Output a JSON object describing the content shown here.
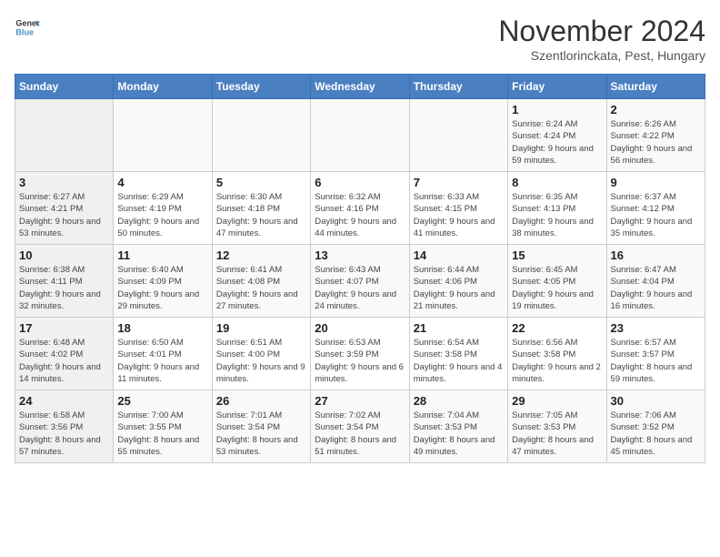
{
  "header": {
    "logo_general": "General",
    "logo_blue": "Blue",
    "title": "November 2024",
    "location": "Szentlorinckata, Pest, Hungary"
  },
  "days_of_week": [
    "Sunday",
    "Monday",
    "Tuesday",
    "Wednesday",
    "Thursday",
    "Friday",
    "Saturday"
  ],
  "weeks": [
    [
      {
        "day": "",
        "info": ""
      },
      {
        "day": "",
        "info": ""
      },
      {
        "day": "",
        "info": ""
      },
      {
        "day": "",
        "info": ""
      },
      {
        "day": "",
        "info": ""
      },
      {
        "day": "1",
        "info": "Sunrise: 6:24 AM\nSunset: 4:24 PM\nDaylight: 9 hours and 59 minutes."
      },
      {
        "day": "2",
        "info": "Sunrise: 6:26 AM\nSunset: 4:22 PM\nDaylight: 9 hours and 56 minutes."
      }
    ],
    [
      {
        "day": "3",
        "info": "Sunrise: 6:27 AM\nSunset: 4:21 PM\nDaylight: 9 hours and 53 minutes."
      },
      {
        "day": "4",
        "info": "Sunrise: 6:29 AM\nSunset: 4:19 PM\nDaylight: 9 hours and 50 minutes."
      },
      {
        "day": "5",
        "info": "Sunrise: 6:30 AM\nSunset: 4:18 PM\nDaylight: 9 hours and 47 minutes."
      },
      {
        "day": "6",
        "info": "Sunrise: 6:32 AM\nSunset: 4:16 PM\nDaylight: 9 hours and 44 minutes."
      },
      {
        "day": "7",
        "info": "Sunrise: 6:33 AM\nSunset: 4:15 PM\nDaylight: 9 hours and 41 minutes."
      },
      {
        "day": "8",
        "info": "Sunrise: 6:35 AM\nSunset: 4:13 PM\nDaylight: 9 hours and 38 minutes."
      },
      {
        "day": "9",
        "info": "Sunrise: 6:37 AM\nSunset: 4:12 PM\nDaylight: 9 hours and 35 minutes."
      }
    ],
    [
      {
        "day": "10",
        "info": "Sunrise: 6:38 AM\nSunset: 4:11 PM\nDaylight: 9 hours and 32 minutes."
      },
      {
        "day": "11",
        "info": "Sunrise: 6:40 AM\nSunset: 4:09 PM\nDaylight: 9 hours and 29 minutes."
      },
      {
        "day": "12",
        "info": "Sunrise: 6:41 AM\nSunset: 4:08 PM\nDaylight: 9 hours and 27 minutes."
      },
      {
        "day": "13",
        "info": "Sunrise: 6:43 AM\nSunset: 4:07 PM\nDaylight: 9 hours and 24 minutes."
      },
      {
        "day": "14",
        "info": "Sunrise: 6:44 AM\nSunset: 4:06 PM\nDaylight: 9 hours and 21 minutes."
      },
      {
        "day": "15",
        "info": "Sunrise: 6:45 AM\nSunset: 4:05 PM\nDaylight: 9 hours and 19 minutes."
      },
      {
        "day": "16",
        "info": "Sunrise: 6:47 AM\nSunset: 4:04 PM\nDaylight: 9 hours and 16 minutes."
      }
    ],
    [
      {
        "day": "17",
        "info": "Sunrise: 6:48 AM\nSunset: 4:02 PM\nDaylight: 9 hours and 14 minutes."
      },
      {
        "day": "18",
        "info": "Sunrise: 6:50 AM\nSunset: 4:01 PM\nDaylight: 9 hours and 11 minutes."
      },
      {
        "day": "19",
        "info": "Sunrise: 6:51 AM\nSunset: 4:00 PM\nDaylight: 9 hours and 9 minutes."
      },
      {
        "day": "20",
        "info": "Sunrise: 6:53 AM\nSunset: 3:59 PM\nDaylight: 9 hours and 6 minutes."
      },
      {
        "day": "21",
        "info": "Sunrise: 6:54 AM\nSunset: 3:58 PM\nDaylight: 9 hours and 4 minutes."
      },
      {
        "day": "22",
        "info": "Sunrise: 6:56 AM\nSunset: 3:58 PM\nDaylight: 9 hours and 2 minutes."
      },
      {
        "day": "23",
        "info": "Sunrise: 6:57 AM\nSunset: 3:57 PM\nDaylight: 8 hours and 59 minutes."
      }
    ],
    [
      {
        "day": "24",
        "info": "Sunrise: 6:58 AM\nSunset: 3:56 PM\nDaylight: 8 hours and 57 minutes."
      },
      {
        "day": "25",
        "info": "Sunrise: 7:00 AM\nSunset: 3:55 PM\nDaylight: 8 hours and 55 minutes."
      },
      {
        "day": "26",
        "info": "Sunrise: 7:01 AM\nSunset: 3:54 PM\nDaylight: 8 hours and 53 minutes."
      },
      {
        "day": "27",
        "info": "Sunrise: 7:02 AM\nSunset: 3:54 PM\nDaylight: 8 hours and 51 minutes."
      },
      {
        "day": "28",
        "info": "Sunrise: 7:04 AM\nSunset: 3:53 PM\nDaylight: 8 hours and 49 minutes."
      },
      {
        "day": "29",
        "info": "Sunrise: 7:05 AM\nSunset: 3:53 PM\nDaylight: 8 hours and 47 minutes."
      },
      {
        "day": "30",
        "info": "Sunrise: 7:06 AM\nSunset: 3:52 PM\nDaylight: 8 hours and 45 minutes."
      }
    ]
  ]
}
